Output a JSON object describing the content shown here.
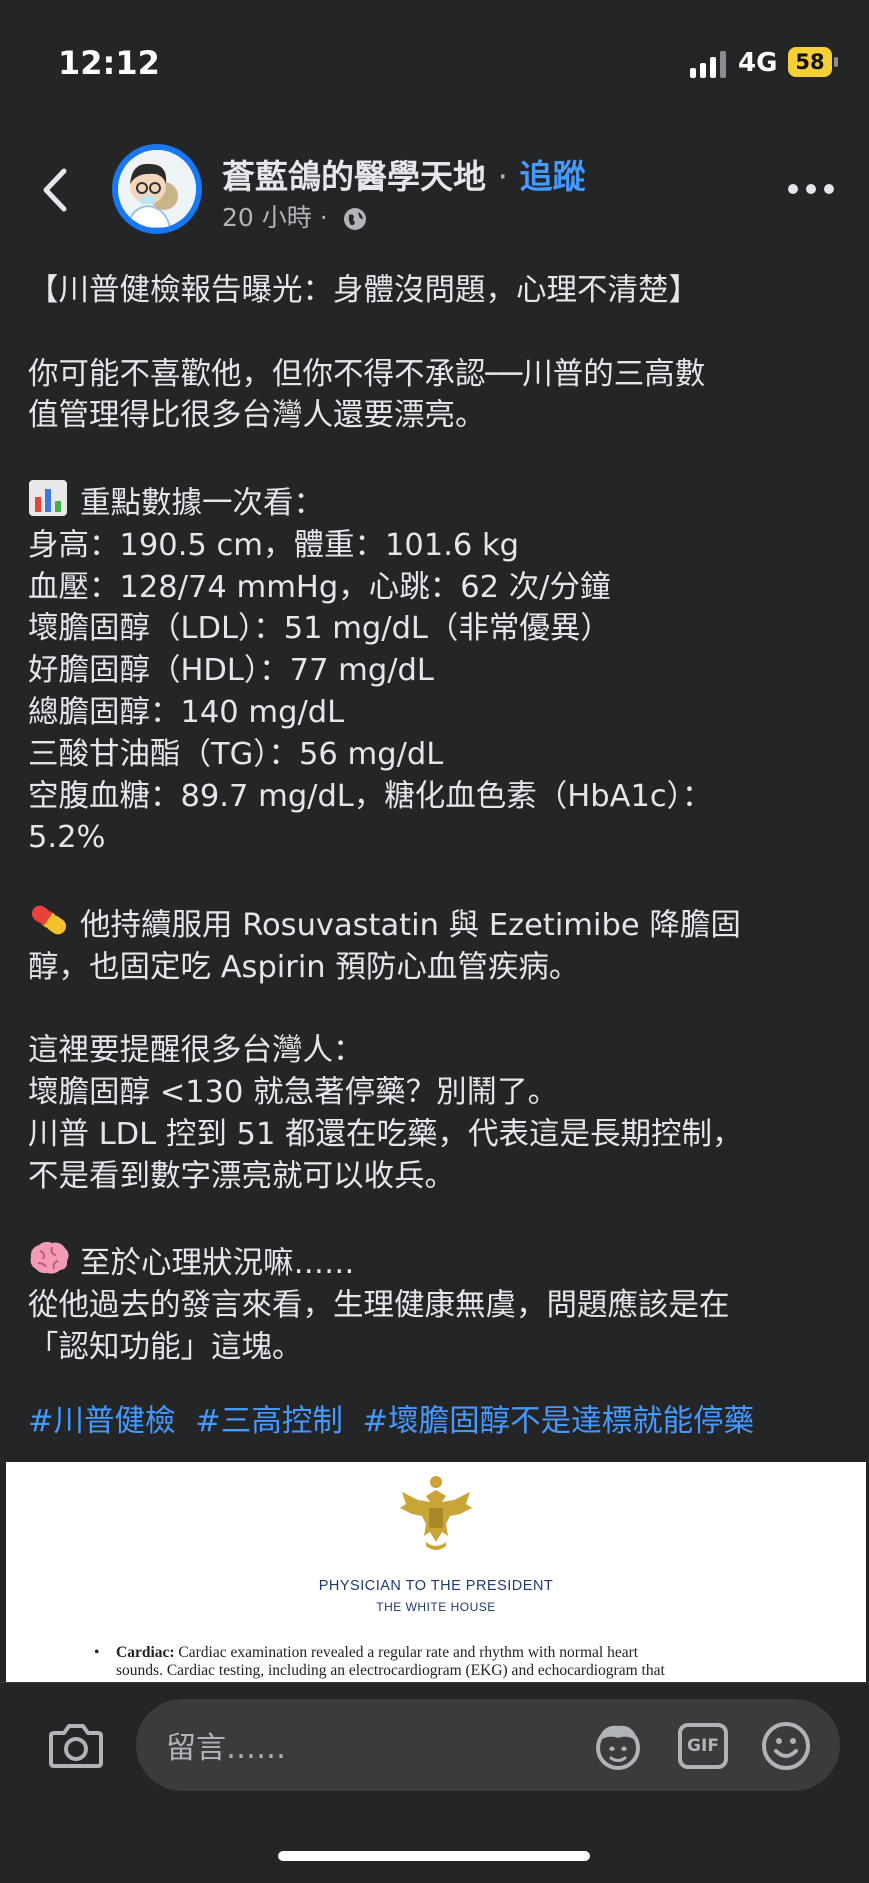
{
  "status_bar": {
    "time": "12:12",
    "network": "4G",
    "battery": "58",
    "battery_color": "#f7d038"
  },
  "header": {
    "page_name": "蒼藍鴿的醫學天地",
    "separator": "·",
    "follow_label": "追蹤",
    "timestamp": "20 小時",
    "meta_dot": "·",
    "audience_icon": "globe-icon",
    "accent_color": "#4599ff"
  },
  "post": {
    "lines": [
      "【川普健檢報告曝光：身體沒問題，心理不清楚】",
      "",
      "你可能不喜歡他，但你不得不承認──川普的三高數",
      "值管理得比很多台灣人還要漂亮。",
      "",
      "重點數據一次看：",
      "身高：190.5 cm，體重：101.6 kg",
      "血壓：128/74 mmHg，心跳：62 次/分鐘",
      "壞膽固醇（LDL）：51 mg/dL（非常優異）",
      "好膽固醇（HDL）：77 mg/dL",
      "總膽固醇：140 mg/dL",
      "三酸甘油酯（TG）：56 mg/dL",
      "空腹血糖：89.7 mg/dL，糖化血色素（HbA1c）：",
      "5.2%",
      "",
      "他持續服用 Rosuvastatin 與 Ezetimibe 降膽固",
      "醇，也固定吃 Aspirin 預防心血管疾病。",
      "",
      "這裡要提醒很多台灣人：",
      "壞膽固醇 <130 就急著停藥？別鬧了。",
      "川普 LDL 控到 51 都還在吃藥，代表這是長期控制，",
      "不是看到數字漂亮就可以收兵。",
      "",
      "至於心理狀況嘛……",
      "從他過去的發言來看，生理健康無虞，問題應該是在",
      "「認知功能」這塊。"
    ],
    "hashtags": [
      "#川普健檢",
      "#三高控制",
      "#壞膽固醇不是達標就能停藥"
    ]
  },
  "attachment": {
    "title": "PHYSICIAN TO THE PRESIDENT",
    "subtitle": "THE WHITE HOUSE",
    "bullet": "•",
    "label": "Cardiac:",
    "body_line1": " Cardiac examination revealed a regular rate and rhythm with normal heart",
    "body_line2": "sounds. Cardiac testing, including an electrocardiogram (EKG) and echocardiogram that"
  },
  "comment_bar": {
    "placeholder": "留言……",
    "gif_label": "GIF"
  }
}
